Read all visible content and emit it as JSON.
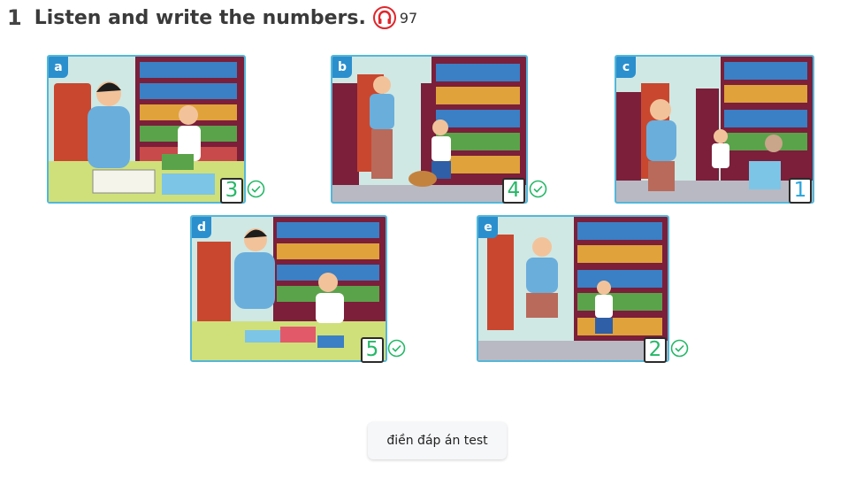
{
  "question": {
    "number": "1",
    "title": "Listen and write the numbers.",
    "track": "97",
    "icon": "headphones-icon"
  },
  "cards": [
    {
      "letter": "a",
      "answer": "3",
      "status": "correct"
    },
    {
      "letter": "b",
      "answer": "4",
      "status": "correct"
    },
    {
      "letter": "c",
      "answer": "1",
      "status": "example"
    },
    {
      "letter": "d",
      "answer": "5",
      "status": "correct"
    },
    {
      "letter": "e",
      "answer": "2",
      "status": "correct"
    }
  ],
  "button": {
    "label": "điền đáp án test"
  },
  "colors": {
    "correct": "#26b868",
    "example": "#27a4db",
    "frame": "#53b7d9",
    "badge": "#2b8fce"
  }
}
